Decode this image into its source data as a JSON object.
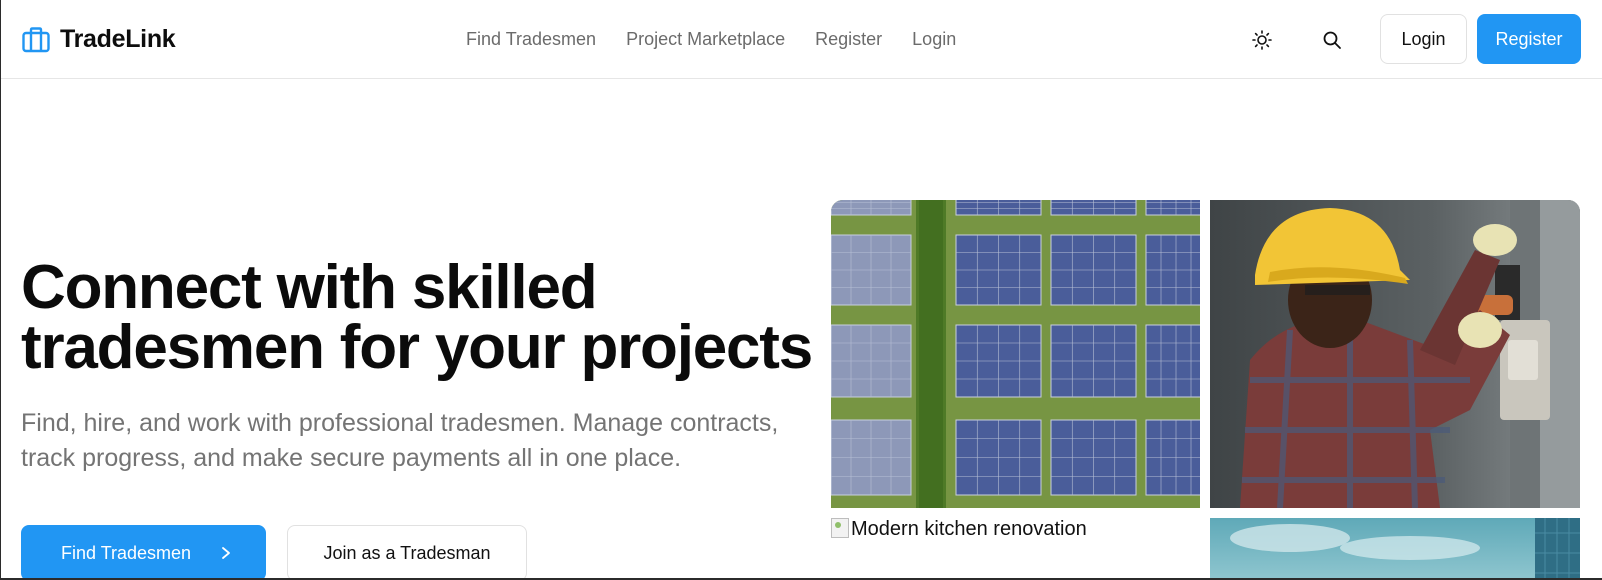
{
  "brand": {
    "name": "TradeLink",
    "icon": "briefcase-icon",
    "accent": "#2196f3"
  },
  "nav": {
    "links": [
      "Find Tradesmen",
      "Project Marketplace",
      "Register",
      "Login"
    ]
  },
  "header_actions": {
    "theme_icon": "sun-icon",
    "search_icon": "search-icon",
    "login_label": "Login",
    "register_label": "Register"
  },
  "hero": {
    "title_lines": [
      "Connect with skilled",
      "tradesmen for your projects"
    ],
    "subtitle_lines": [
      "Find, hire, and work with professional tradesmen. Manage contracts,",
      "track progress, and make secure payments all in one place."
    ],
    "primary_cta": "Find Tradesmen",
    "primary_cta_icon": "chevron-right-icon",
    "secondary_cta": "Join as a Tradesman"
  },
  "gallery": {
    "images": [
      {
        "subject": "solar-panels-aerial"
      },
      {
        "subject": "electrician-working"
      },
      {
        "alt": "Modern kitchen renovation",
        "broken": true
      },
      {
        "subject": "sky-solar-panel"
      }
    ]
  },
  "colors": {
    "primary": "#2196f3",
    "muted_text": "#747474",
    "nav_text": "#6b6b6b"
  }
}
